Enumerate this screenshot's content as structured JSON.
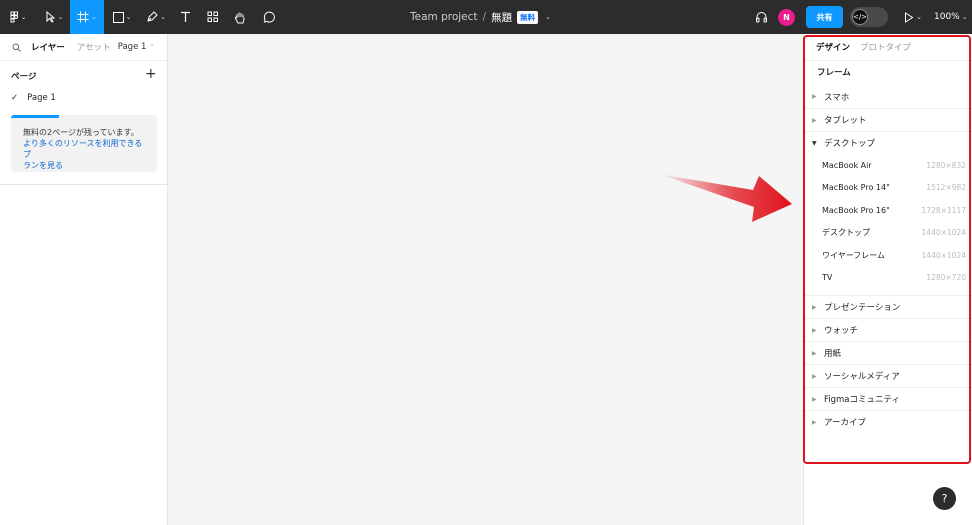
{
  "toolbar": {
    "project": "Team project",
    "separator": "/",
    "file_name": "無題",
    "plan_badge": "無料",
    "avatar_initial": "N",
    "share_label": "共有",
    "zoom": "100%"
  },
  "left_panel": {
    "tabs": [
      "レイヤー",
      "アセット"
    ],
    "page_selector": "Page 1",
    "pages_heading": "ページ",
    "pages": [
      "Page 1"
    ],
    "promo": {
      "message": "無料の2ページが残っています。",
      "link_line1": "より多くのリソースを利用できるプ",
      "link_line2": "ランを見る"
    }
  },
  "right_panel": {
    "tabs": [
      "デザイン",
      "プロトタイプ"
    ],
    "heading": "フレーム",
    "categories_top": [
      "スマホ",
      "タブレット"
    ],
    "open_category": "デスクトップ",
    "presets": [
      {
        "name": "MacBook Air",
        "size": "1280×832"
      },
      {
        "name": "MacBook Pro 14\"",
        "size": "1512×982"
      },
      {
        "name": "MacBook Pro 16\"",
        "size": "1728×1117"
      },
      {
        "name": "デスクトップ",
        "size": "1440×1024"
      },
      {
        "name": "ワイヤーフレーム",
        "size": "1440×1024"
      },
      {
        "name": "TV",
        "size": "1280×720"
      }
    ],
    "categories_bottom": [
      "プレゼンテーション",
      "ウォッチ",
      "用紙",
      "ソーシャルメディア",
      "Figmaコミュニティ",
      "アーカイブ"
    ]
  },
  "help_label": "?",
  "colors": {
    "accent": "#0d99ff",
    "toolbar_bg": "#2c2c2c",
    "highlight": "#e0121b"
  }
}
